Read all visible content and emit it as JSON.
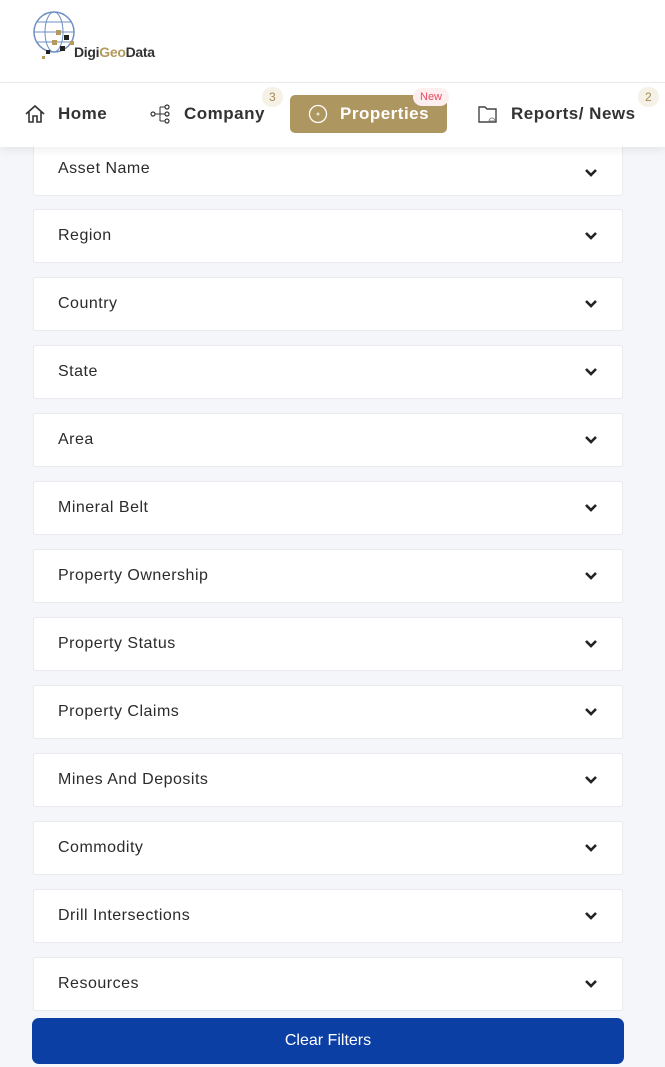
{
  "brand": {
    "logo_text": "DigiGeoData",
    "accent": "#ae9660"
  },
  "nav": [
    {
      "label": "Home",
      "icon": "home-icon"
    },
    {
      "label": "Company",
      "icon": "hierarchy-icon",
      "badge": "3"
    },
    {
      "label": "Properties",
      "icon": "target-icon",
      "badge": "New",
      "active": true
    },
    {
      "label": "Reports/ News",
      "icon": "folder-icon",
      "badge": "2"
    }
  ],
  "filters": [
    "Asset Name",
    "Region",
    "Country",
    "State",
    "Area",
    "Mineral Belt",
    "Property Ownership",
    "Property Status",
    "Property Claims",
    "Mines And Deposits",
    "Commodity",
    "Drill Intersections",
    "Resources"
  ],
  "clear_label": "Clear Filters",
  "button_color": "#0c3fa4"
}
